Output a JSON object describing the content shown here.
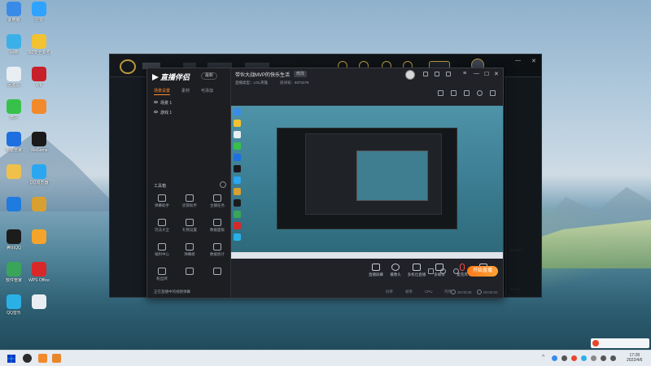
{
  "desktop": {
    "icons": [
      {
        "label": "此电脑",
        "color": "#3a8be8"
      },
      {
        "label": "迅雷",
        "color": "#2fa3ff"
      },
      {
        "label": "网络",
        "color": "#3bb0e8"
      },
      {
        "label": "360安全浏览器",
        "color": "#f2c230"
      },
      {
        "label": "回收站",
        "color": "#e9eef3"
      },
      {
        "label": "WE",
        "color": "#c8202a"
      },
      {
        "label": "微信",
        "color": "#38c14a"
      },
      {
        "label": "",
        "color": "#f28a2c"
      },
      {
        "label": "电脑管家",
        "color": "#1e6fe0"
      },
      {
        "label": "WeGame",
        "color": "#1a1a1a"
      },
      {
        "label": "",
        "color": "#f0c14a"
      },
      {
        "label": "QQ浏览器",
        "color": "#2aa7f0"
      },
      {
        "label": "",
        "color": "#1f7be0"
      },
      {
        "label": "",
        "color": "#d8a030"
      },
      {
        "label": "腾讯QQ",
        "color": "#1c1c1c"
      },
      {
        "label": "",
        "color": "#f4a42a"
      },
      {
        "label": "软件管家",
        "color": "#3aa55a"
      },
      {
        "label": "WPS Office",
        "color": "#d8282a"
      },
      {
        "label": "QQ音乐",
        "color": "#2bb0e6"
      },
      {
        "label": "",
        "color": "#e9eef3"
      }
    ]
  },
  "studio": {
    "brand": "直播伴侣",
    "version": "最新",
    "tabs": [
      "场景设置",
      "素材",
      "可添加"
    ],
    "scenes": [
      "场景 1",
      "游戏 1"
    ],
    "tools_title": "工具箱",
    "tools": [
      "弹幕助手",
      "房管助手",
      "主播任务",
      "玩法大全",
      "礼物设置",
      "数据面板",
      "福利中心",
      "弹幕姬",
      "数据统计",
      "粉丝牌",
      "",
      ""
    ],
    "status_left": "正在直播中的视频弹幕",
    "room_title": "带伙大战MVP的快乐生活",
    "edit_label": "修改",
    "room_sub_1": "直播类型：LOL英雄",
    "room_sub_2": "房间号：9372275",
    "controls": [
      "直播屏幕",
      "摄像头",
      "多机位直播",
      "多媒体",
      "麦克风",
      "扬声器"
    ],
    "go_live": "开始直播",
    "stats": [
      "码率",
      "帧率",
      "CPU",
      "内存",
      "00:00:05",
      "00:00:00"
    ]
  },
  "window_controls": {
    "minimize": "—",
    "maximize": "☐",
    "close": "✕"
  },
  "taskbar": {
    "time": "17:28",
    "date": "2022/4/6"
  }
}
